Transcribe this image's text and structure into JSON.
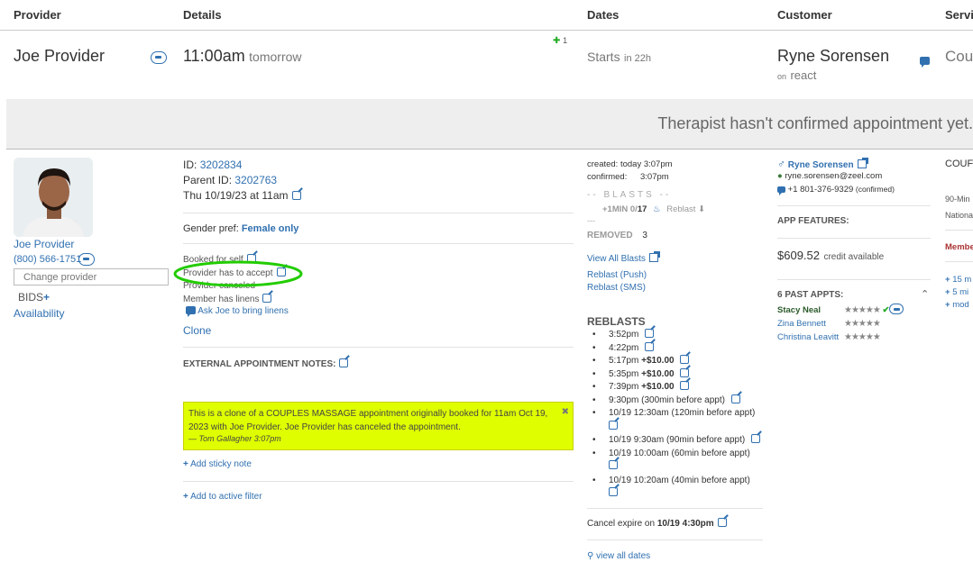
{
  "header": {
    "provider": "Provider",
    "details": "Details",
    "dates": "Dates",
    "customer": "Customer",
    "service": "Servi"
  },
  "row": {
    "provider_name": "Joe Provider",
    "time": "11:00am",
    "time_suffix": "tomorrow",
    "pin_count": "1",
    "starts": "Starts",
    "starts_in": "in 22h",
    "customer_name": "Ryne Sorensen",
    "customer_on": "on",
    "customer_platform": "react",
    "service_short": "Cou"
  },
  "banner": {
    "text": "Therapist hasn't confirmed appointment yet."
  },
  "provider": {
    "name": "Joe Provider",
    "phone": "(800) 566-1751",
    "change_placeholder": "Change provider",
    "bids": "BIDS",
    "availability": "Availability"
  },
  "details": {
    "id_label": "ID:",
    "id": "3202834",
    "parent_label": "Parent ID:",
    "parent_id": "3202763",
    "datetime": "Thu 10/19/23 at 11am",
    "gender_label": "Gender pref:",
    "gender_value": "Female only",
    "booked_for": "Booked for self",
    "provider_accept": "Provider has to accept",
    "provider_canceled": "Provider canceled",
    "member_linens": "Member has linens",
    "ask_linens": "Ask Joe to bring linens",
    "clone": "Clone",
    "ext_notes": "EXTERNAL APPOINTMENT NOTES:",
    "note_text": "This is a clone of a COUPLES MASSAGE appointment originally booked for 11am Oct 19, 2023 with Joe Provider. Joe Provider has canceled the appointment.",
    "note_author": "— Tom Gallagher 3:07pm",
    "note_close": "✖",
    "add_sticky": "Add sticky note",
    "add_filter": "Add to active filter"
  },
  "dates": {
    "created_label": "created:",
    "created_value": "today 3:07pm",
    "confirmed_label": "confirmed:",
    "confirmed_value": "3:07pm",
    "blasts_title": "-- BLASTS --",
    "blast_min": "+1MIN",
    "blast_count": "0/",
    "blast_total": "17",
    "reblast_label": "Reblast",
    "dashes": "---",
    "removed_label": "REMOVED",
    "removed_count": "3",
    "view_all_blasts": "View All Blasts",
    "reblast_push": "Reblast (Push)",
    "reblast_sms": "Reblast (SMS)",
    "reblasts_title": "REBLASTS",
    "reblasts": [
      {
        "time": "3:52pm",
        "extra": ""
      },
      {
        "time": "4:22pm",
        "extra": ""
      },
      {
        "time": "5:17pm",
        "extra": "+$10.00"
      },
      {
        "time": "5:35pm",
        "extra": "+$10.00"
      },
      {
        "time": "7:39pm",
        "extra": "+$10.00"
      },
      {
        "time": "9:30pm",
        "extra": "(300min before appt)"
      },
      {
        "time": "10/19 12:30am",
        "extra": "(120min before appt)"
      },
      {
        "time": "10/19 9:30am",
        "extra": "(90min before appt)"
      },
      {
        "time": "10/19 10:00am",
        "extra": "(60min before appt)"
      },
      {
        "time": "10/19 10:20am",
        "extra": "(40min before appt)"
      }
    ],
    "cancel_expire_label": "Cancel expire on",
    "cancel_expire_value": "10/19 4:30pm",
    "view_all_dates": "view all dates"
  },
  "customer": {
    "name": "Ryne Sorensen",
    "email": "ryne.sorensen@zeel.com",
    "phone": "+1 801-376-9329",
    "phone_status": "(confirmed)",
    "app_features": "APP FEATURES:",
    "credit_amount": "$609.52",
    "credit_label": "credit available",
    "past_appts": "6 PAST APPTS:",
    "past": [
      {
        "name": "Stacy Neal",
        "stars": "★★★★★"
      },
      {
        "name": "Zina Bennett",
        "stars": "★★★★★"
      },
      {
        "name": "Christina Leavitt",
        "stars": "★★★★★"
      }
    ]
  },
  "service": {
    "title": "COUF",
    "line1": "90-Min",
    "line2": "Nationa",
    "member": "Membe",
    "link1": "15 m",
    "link2": "5 mi",
    "link3": "mod"
  },
  "colors": {
    "link": "#3070b0",
    "note_bg": "#dfff00",
    "highlight": "#22cc00"
  }
}
